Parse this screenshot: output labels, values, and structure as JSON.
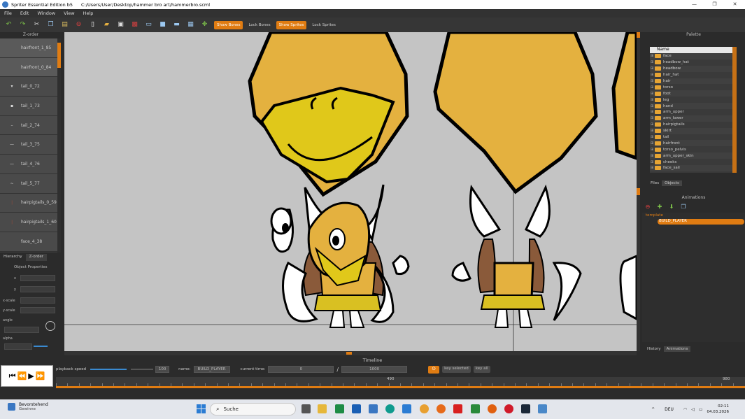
{
  "window": {
    "title": "Spriter Essential Edition b5",
    "path": "C:/Users/User/Desktop/hammer bro art/hammerbro.scml",
    "controls": [
      "—",
      "❐",
      "✕"
    ]
  },
  "menu": [
    "File",
    "Edit",
    "Window",
    "View",
    "Help"
  ],
  "toolbar": {
    "show_bones": "Show Bones",
    "lock_bones": "Lock Bones",
    "show_sprites": "Show Sprites",
    "lock_sprites": "Lock Sprites"
  },
  "zorder": {
    "title": "Z-order",
    "items": [
      "hairfront_1_85",
      "hairfront_0_84",
      "tail_0_72",
      "tail_1_73",
      "tail_2_74",
      "tail_3_75",
      "tail_4_76",
      "tail_5_77",
      "hairpigtails_0_59",
      "hairpigtails_1_60",
      "face_4_38"
    ]
  },
  "left_tabs": [
    "Hierarchy",
    "Z-order"
  ],
  "object_properties": {
    "title": "Object Properties",
    "labels": [
      "x",
      "y",
      "x-scale",
      "y-scale",
      "angle",
      "alpha"
    ]
  },
  "palette": {
    "title": "Palette",
    "column": "Name",
    "folders": [
      "face",
      "headbow_hat",
      "headbow",
      "hair_hat",
      "hair",
      "torso",
      "foot",
      "leg",
      "hand",
      "arm_upper",
      "arm_lower",
      "hairpigtails",
      "skirt",
      "tail",
      "hairfront",
      "torso_pelvis",
      "arm_upper_skin",
      "cheeks",
      "face_sail"
    ],
    "tabs": [
      "Files",
      "Objects"
    ]
  },
  "animations": {
    "title": "Animations",
    "entity": "template",
    "selected": "BUILD_PLAYER",
    "tabs": [
      "History",
      "Animations"
    ]
  },
  "timeline": {
    "title": "Timeline",
    "playback_speed_label": "playback speed",
    "playback_speed": "100",
    "name_label": "name:",
    "name_value": "BUILD_PLAYER",
    "current_time_label": "current time:",
    "current_time": "0",
    "separator": "/",
    "length": "1000",
    "key_selected": "key selected",
    "key_all": "key all",
    "ruler": [
      "490",
      "980"
    ]
  },
  "taskbar": {
    "weather_title": "Bevorstehend",
    "weather_sub": "Gewinne",
    "search": "Suche",
    "lang": "DEU",
    "time": "02:11",
    "date": "04.03.2026"
  },
  "colors": {
    "accent": "#e07c12",
    "canvas_bg": "#c4c4c4",
    "beak_dark": "#e4b13f",
    "beak_light": "#e0c81a"
  }
}
